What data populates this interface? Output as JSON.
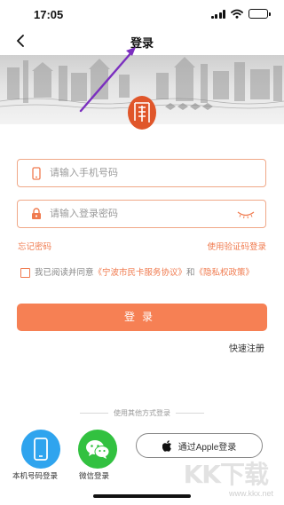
{
  "status_bar": {
    "time": "17:05",
    "battery_level": 0.85
  },
  "nav": {
    "title": "登录"
  },
  "form": {
    "phone_placeholder": "请输入手机号码",
    "password_placeholder": "请输入登录密码"
  },
  "links": {
    "forgot_password": "忘记密码",
    "sms_login": "使用验证码登录"
  },
  "agreement": {
    "prefix": "我已阅读并同意",
    "service_agreement": "《宁波市民卡服务协议》",
    "conjunction": "和",
    "privacy_policy": "《隐私权政策》"
  },
  "login_button": "登录",
  "register": "快速注册",
  "other_methods": {
    "title": "使用其他方式登录",
    "phone_login": "本机号码登录",
    "wechat_login": "微信登录",
    "apple_login": "通过Apple登录"
  },
  "watermark": {
    "brand": "KK下载",
    "url": "www.kkx.net"
  },
  "colors": {
    "accent": "#f68054",
    "link": "#f07a4e",
    "border": "#f0a888",
    "seal": "#e0562a"
  },
  "icons": [
    "back-arrow",
    "phone",
    "lock",
    "eye-closed",
    "checkbox",
    "mobile-phone",
    "wechat",
    "apple"
  ]
}
